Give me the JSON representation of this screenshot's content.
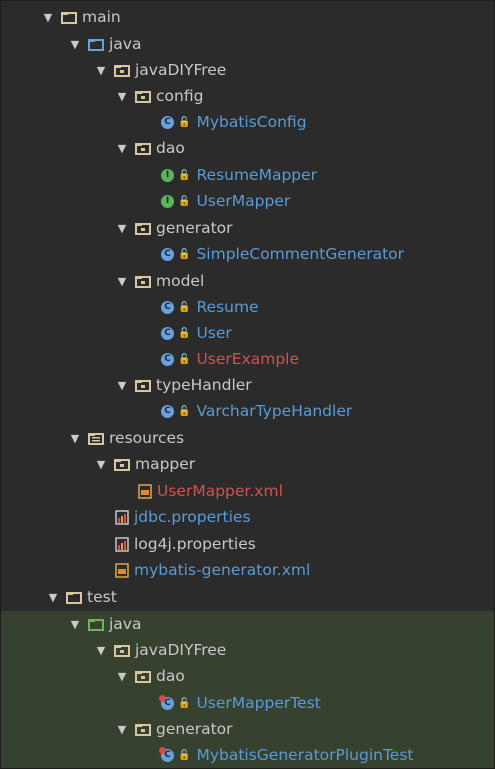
{
  "tree": {
    "main": "main",
    "main_java": "java",
    "main_pkg": "javaDIYFree",
    "config": "config",
    "mybatis_config": "MybatisConfig",
    "dao": "dao",
    "resume_mapper": "ResumeMapper",
    "user_mapper": "UserMapper",
    "generator": "generator",
    "simple_comment_generator": "SimpleCommentGenerator",
    "model": "model",
    "resume": "Resume",
    "user": "User",
    "user_example": "UserExample",
    "type_handler": "typeHandler",
    "varchar_type_handler": "VarcharTypeHandler",
    "resources": "resources",
    "mapper": "mapper",
    "user_mapper_xml": "UserMapper.xml",
    "jdbc_properties": "jdbc.properties",
    "log4j_properties": "log4j.properties",
    "mybatis_generator_xml": "mybatis-generator.xml",
    "test": "test",
    "test_java": "java",
    "test_pkg": "javaDIYFree",
    "test_dao": "dao",
    "user_mapper_test": "UserMapperTest",
    "test_generator": "generator",
    "mybatis_generator_plugin_test": "MybatisGeneratorPluginTest"
  },
  "colors": {
    "background": "#2b2b2b",
    "test_background": "#36412f",
    "text": "#c8c8c8",
    "class_blue": "#5b9bd5",
    "modified_red": "#d25252",
    "folder_beige": "#d7c7a0",
    "source_folder_blue": "#6aa0de",
    "test_folder_green": "#76b05a"
  },
  "icons": {
    "expand": "triangle-down",
    "folder": "folder-icon",
    "package": "package-icon",
    "class": "class-c-icon",
    "interface": "interface-i-icon",
    "test_class": "test-class-icon",
    "xml": "xml-file-icon",
    "properties": "properties-file-icon"
  }
}
